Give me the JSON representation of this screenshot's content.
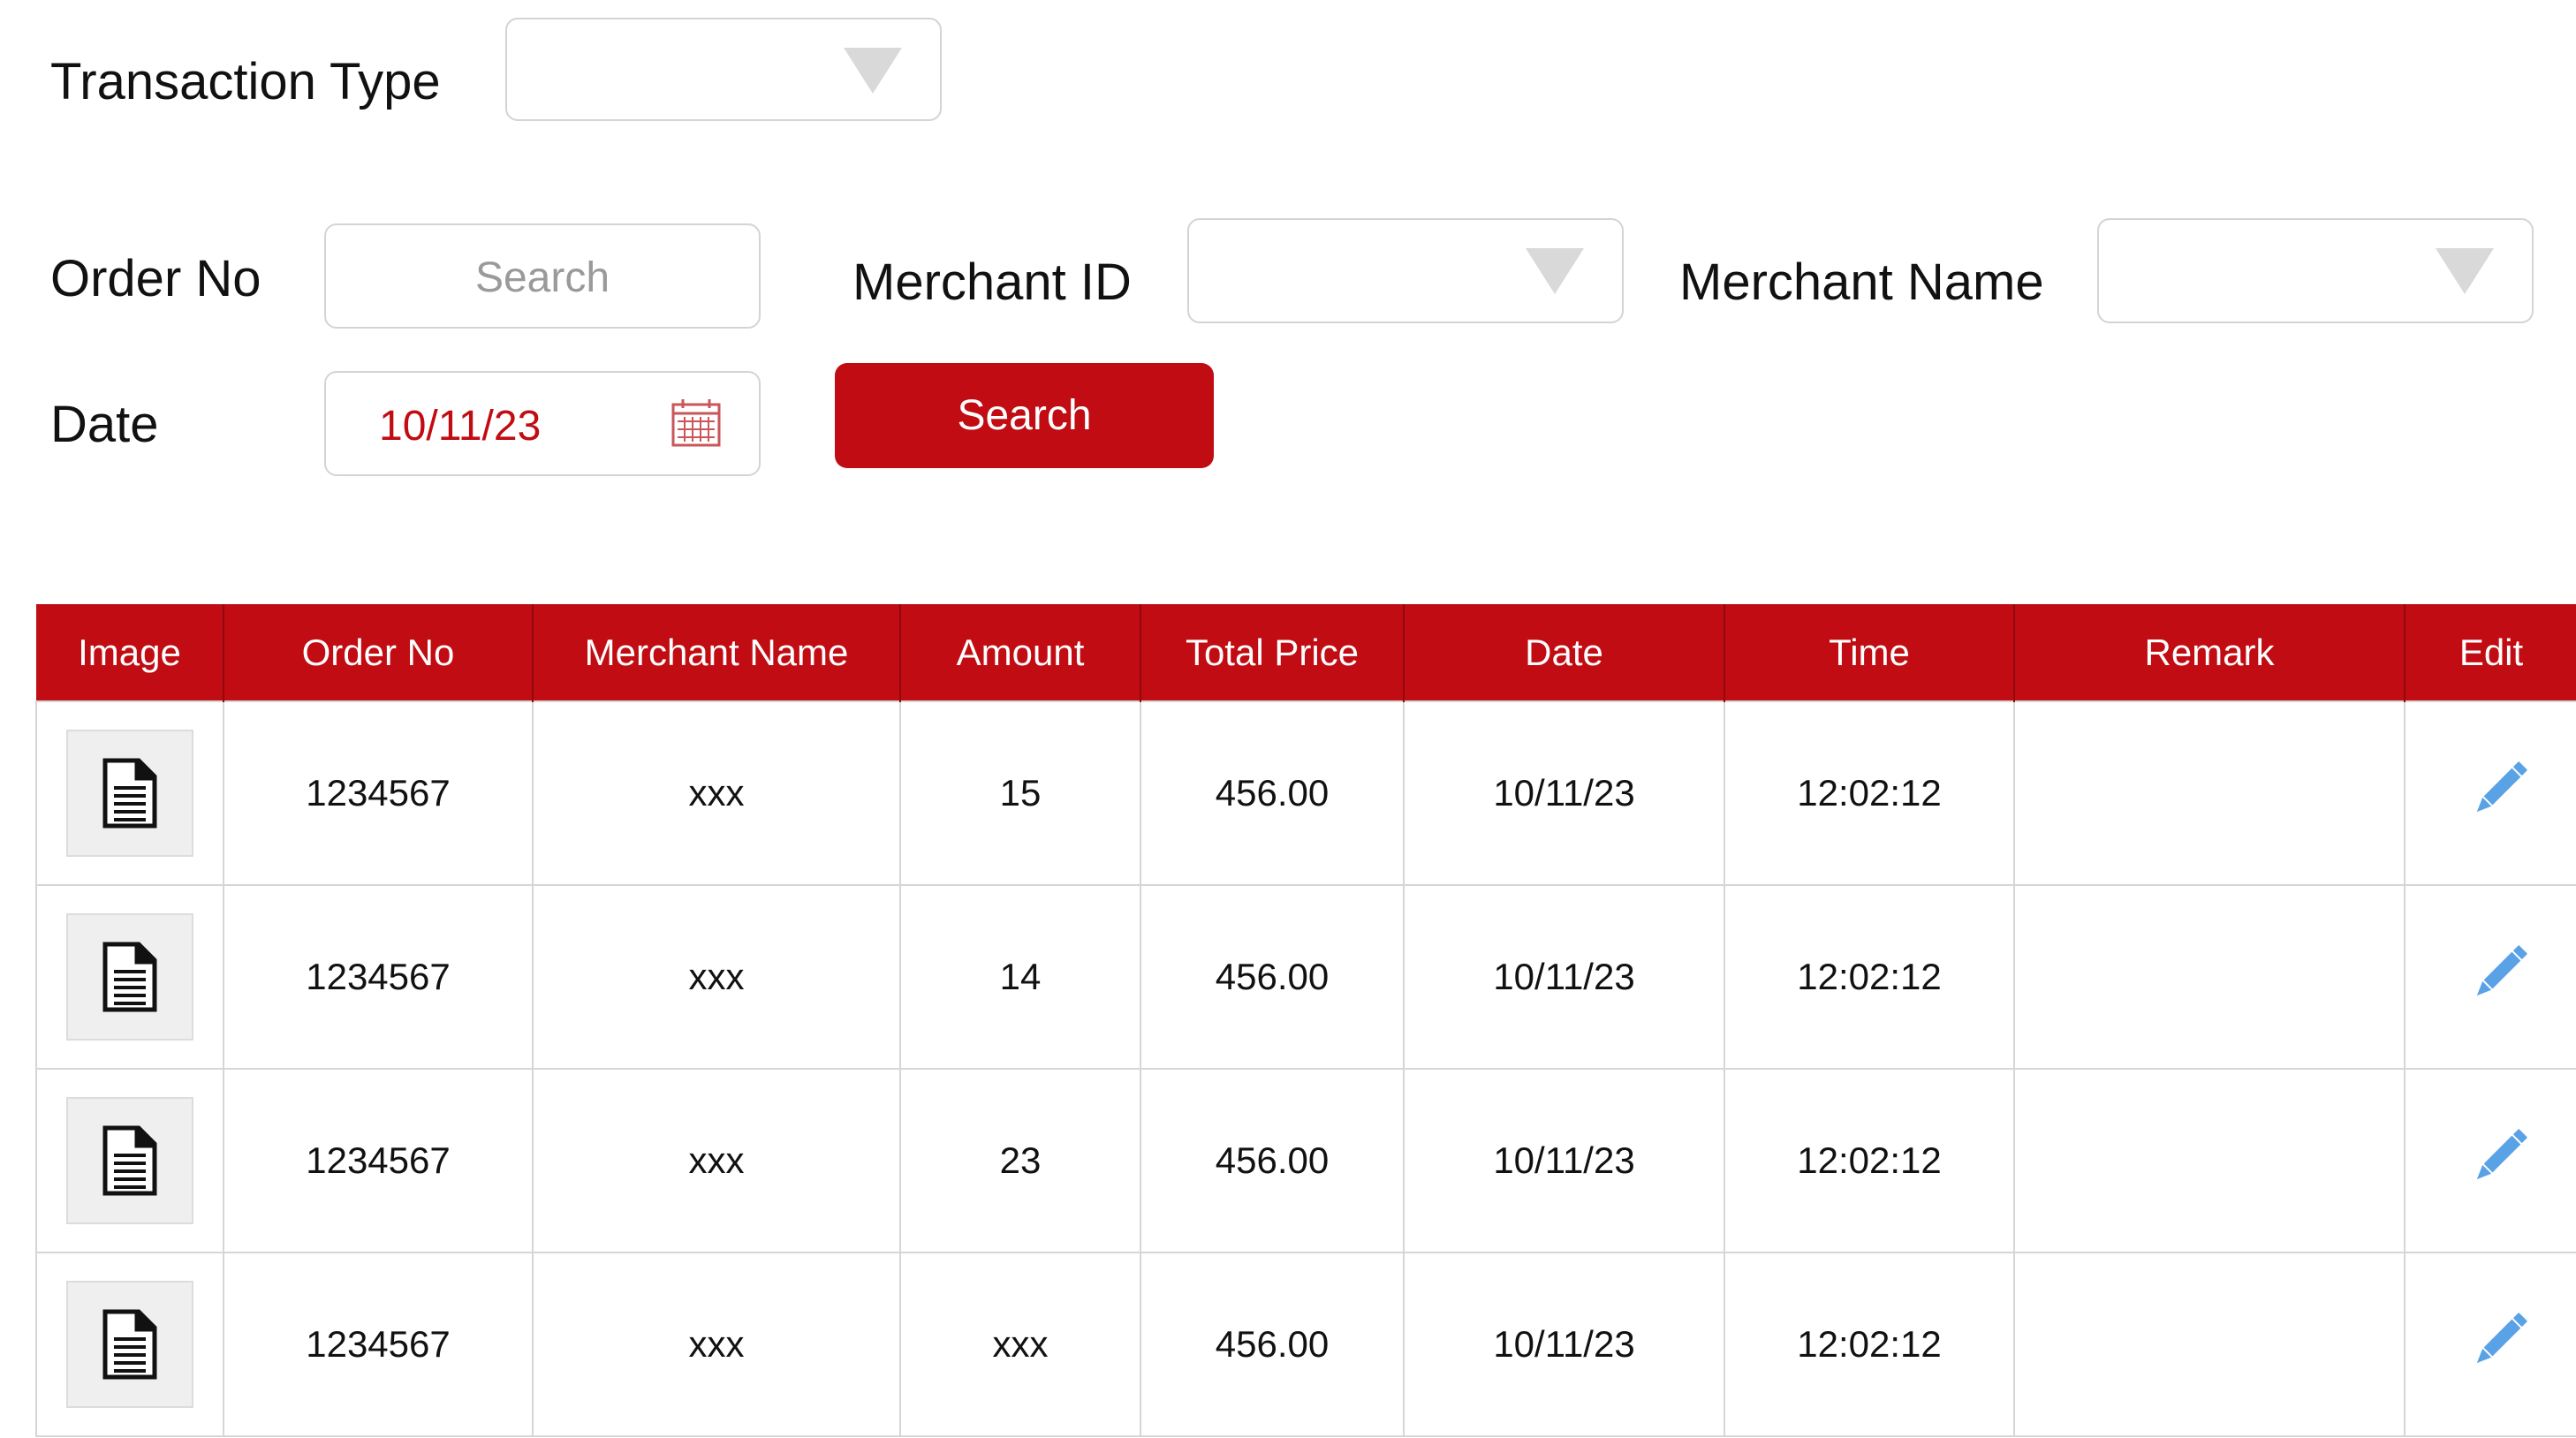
{
  "filters": {
    "transaction_type_label": "Transaction Type",
    "transaction_type_value": "",
    "order_no_label": "Order No",
    "order_no_placeholder": "Search",
    "merchant_id_label": "Merchant ID",
    "merchant_id_value": "",
    "merchant_name_label": "Merchant Name",
    "merchant_name_value": "",
    "date_label": "Date",
    "date_value": "10/11/23",
    "search_button": "Search"
  },
  "icons": {
    "dropdown": "chevron-down-icon",
    "calendar": "calendar-icon",
    "document": "document-icon",
    "edit": "pencil-icon"
  },
  "colors": {
    "brand_red": "#c00c12",
    "edit_blue": "#5aa2e6",
    "placeholder_gray": "#9a9a9a"
  },
  "table": {
    "columns": [
      "Image",
      "Order No",
      "Merchant Name",
      "Amount",
      "Total Price",
      "Date",
      "Time",
      "Remark",
      "Edit"
    ],
    "rows": [
      {
        "order_no": "1234567",
        "merchant_name": "xxx",
        "amount": "15",
        "total_price": "456.00",
        "date": "10/11/23",
        "time": "12:02:12",
        "remark": ""
      },
      {
        "order_no": "1234567",
        "merchant_name": "xxx",
        "amount": "14",
        "total_price": "456.00",
        "date": "10/11/23",
        "time": "12:02:12",
        "remark": ""
      },
      {
        "order_no": "1234567",
        "merchant_name": "xxx",
        "amount": "23",
        "total_price": "456.00",
        "date": "10/11/23",
        "time": "12:02:12",
        "remark": ""
      },
      {
        "order_no": "1234567",
        "merchant_name": "xxx",
        "amount": "xxx",
        "total_price": "456.00",
        "date": "10/11/23",
        "time": "12:02:12",
        "remark": ""
      }
    ]
  }
}
